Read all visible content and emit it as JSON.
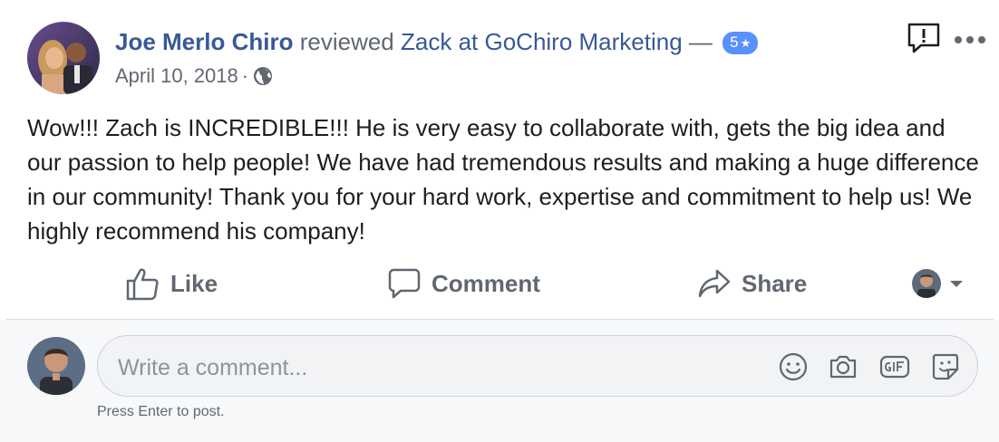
{
  "review": {
    "author": "Joe Merlo Chiro",
    "action": "reviewed",
    "page": "Zack at GoChiro Marketing",
    "dash": "—",
    "rating": "5",
    "rating_star": "★",
    "date": "April 10, 2018",
    "separator": "·",
    "privacy_icon": "globe-icon",
    "text": "Wow!!! Zach is INCREDIBLE!!! He is very easy to collaborate with, gets the big idea and our passion to help people! We have had tremendous results and making a huge difference in our community! Thank you for your hard work, expertise and commitment to help us! We highly recommend his company!"
  },
  "actions": {
    "like": "Like",
    "comment": "Comment",
    "share": "Share"
  },
  "comment_box": {
    "placeholder": "Write a comment...",
    "hint": "Press Enter to post."
  },
  "colors": {
    "link": "#385898",
    "badge": "#5890ff",
    "muted": "#606770"
  }
}
